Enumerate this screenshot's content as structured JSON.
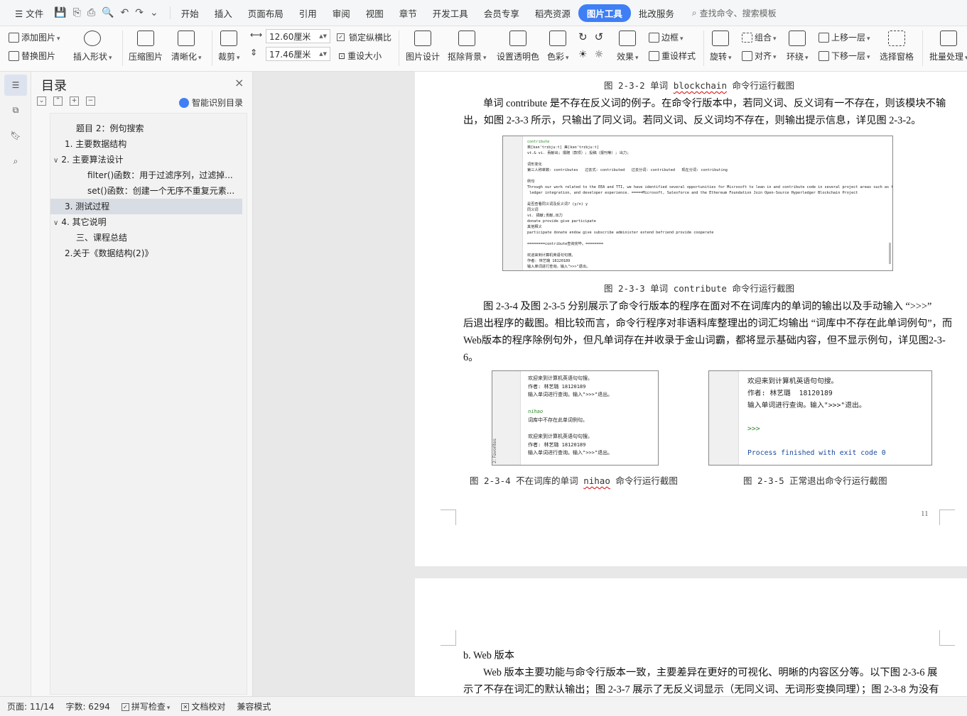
{
  "menubar": {
    "file": "文件",
    "tabs": [
      "开始",
      "插入",
      "页面布局",
      "引用",
      "审阅",
      "视图",
      "章节",
      "开发工具",
      "会员专享",
      "稻壳资源"
    ],
    "active_tab": "图片工具",
    "extra_tab": "批改服务",
    "search_placeholder": "查找命令、搜索模板"
  },
  "toolbar": {
    "add_image": "添加图片",
    "replace_image": "替换图片",
    "insert_shape": "插入形状",
    "compress": "压缩图片",
    "sharpen": "清晰化",
    "crop": "裁剪",
    "width": "12.60厘米",
    "height": "17.46厘米",
    "lock_ratio": "锁定纵横比",
    "reset_size": "重设大小",
    "image_design": "图片设计",
    "remove_bg": "抠除背景",
    "set_transparent": "设置透明色",
    "color": "色彩",
    "effect": "效果",
    "border": "边框",
    "reset_style": "重设样式",
    "rotate": "旋转",
    "group": "组合",
    "align": "对齐",
    "wrap": "环绕",
    "bring_forward": "上移一层",
    "send_backward": "下移一层",
    "select_pane": "选择窗格",
    "batch": "批量处理"
  },
  "toc": {
    "title": "目录",
    "smart_toc": "智能识别目录",
    "items": [
      {
        "label": "题目 2：例句搜索"
      },
      {
        "label": "1. 主要数据结构"
      },
      {
        "label": "2. 主要算法设计"
      },
      {
        "label": "filter()函数：用于过滤序列，过滤掉..."
      },
      {
        "label": "set()函数：创建一个无序不重复元素..."
      },
      {
        "label": "3. 测试过程"
      },
      {
        "label": "4. 其它说明"
      },
      {
        "label": "三、课程总结"
      },
      {
        "label": "2.关于《数据结构(2)》"
      }
    ]
  },
  "doc": {
    "cap_232": "图 2-3-2 单词",
    "cap_232_word": "blockchain",
    "cap_232_tail": "命令行运行截图",
    "para1_line1": "单词 contribute 是不存在反义词的例子。在命令行版本中，若同义词、反义词有一不存在，则该模块不输",
    "para1_line2": "出，如图 2-3-3 所示，只输出了同义词。若同义词、反义词均不存在，则输出提示信息，详见图 2-3-2。",
    "shot1_lines": [
      "contribute",
      "英[kən'trɪbjuːt] 美[kən'trɪbjuːt]",
      "vt.& vi. 贡献出; 捐赠（款项）; 投稿（报刊等）; 出力;",
      "",
      "词形变化",
      "第三人称单数: contributes   过去式: contributed   过去分词: contributed   现在分词: contributing",
      "",
      "例句",
      "Through our work related to the EEA and TTI, we have identified several opportunities for Microsoft to lean in and contribute code in several project areas such as tokens,",
      " ledger integration, and developer experience. =====Microsoft, Salesforce and the Ethereum Foundation Join Open-Source Hyperledger Blockchain Project",
      "",
      "是否查看同义词及反义词? (y/n) y",
      "同义词",
      "vi. 捐献;贡献,出力",
      "donate provide give participate",
      "其他释义",
      "participate donate endow give subscribe administer extend befriend provide cooperate",
      "",
      "========contribute查询完毕。========",
      "",
      "欢迎来到计算机英语句句搜。",
      "作者: 林艺璐 18120189",
      "输入单词进行查询。输入\">>>\"退出。"
    ],
    "cap_233": "图 2-3-3 单词 contribute 命令行运行截图",
    "para2_line1": "图 2-3-4 及图 2-3-5 分别展示了命令行版本的程序在面对不在词库内的单词的输出以及手动输入 “>>>”",
    "para2_line2": "后退出程序的截图。相比较而言，命令行程序对非语料库整理出的词汇均输出 “词库中不存在此单词例句”，而",
    "para2_line3": "Web版本的程序除例句外，但凡单词存在并收录于金山词霸，都将显示基础内容，但不显示例句，详见图2-3-",
    "para2_line4": "6。",
    "shot2_lines": [
      "欢迎来到计算机英语句句搜。",
      "作者: 林艺璐 18120189",
      "输入单词进行查询。输入\">>>\"退出。",
      "",
      "nihao",
      "词库中不存在此单词例句。",
      "",
      "欢迎来到计算机英语句句搜。",
      "作者: 林艺璐 18120189",
      "输入单词进行查询。输入\">>>\"退出。"
    ],
    "shot3_lines": [
      "欢迎来到计算机英语句句搜。",
      "作者: 林艺璐  18120189",
      "输入单词进行查询。输入\">>>\"退出。",
      "",
      ">>>",
      "",
      "Process finished with exit code 0"
    ],
    "favorites": "2: Favorites",
    "cap_234": "图 2-3-4 不在词库的单词",
    "cap_234_word": "nihao",
    "cap_234_tail": "命令行运行截图",
    "cap_235": "图 2-3-5 正常退出命令行运行截图",
    "page_number": "11",
    "section_b": "b. Web 版本",
    "para3_line1": "Web 版本主要功能与命令行版本一致，主要差异在更好的可视化、明晰的内容区分等。以下图 2-3-6 展",
    "para3_line2": "示了不存在词汇的默认输出；图 2-3-7 展示了无反义词显示（无同义词、无词形变换同理）；图 2-3-8 为没有"
  },
  "status": {
    "page": "页面: 11/14",
    "words": "字数: 6294",
    "spell": "拼写检查",
    "proof": "文档校对",
    "compat": "兼容模式"
  },
  "colors": {
    "accent": "#3f7ff5"
  }
}
